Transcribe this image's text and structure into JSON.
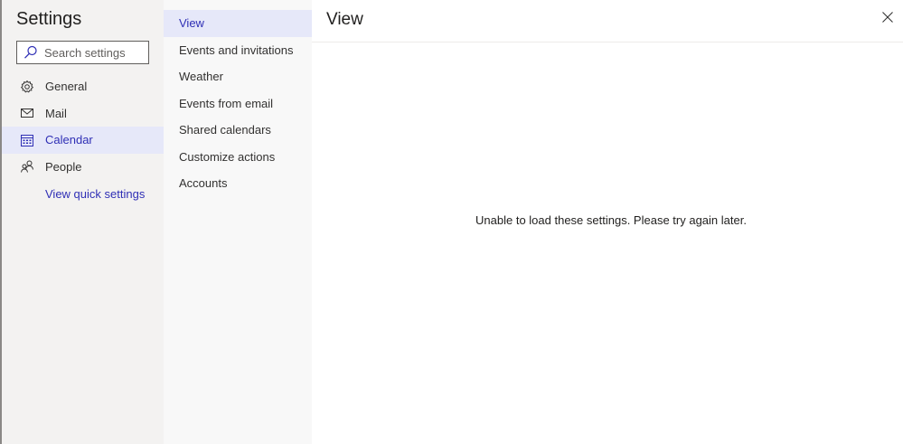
{
  "nav": {
    "title": "Settings",
    "search_placeholder": "Search settings",
    "items": [
      {
        "label": "General",
        "icon": "gear-icon"
      },
      {
        "label": "Mail",
        "icon": "mail-icon"
      },
      {
        "label": "Calendar",
        "icon": "calendar-icon",
        "selected": true
      },
      {
        "label": "People",
        "icon": "people-icon"
      }
    ],
    "quick_settings_link": "View quick settings"
  },
  "subnav": {
    "items": [
      {
        "label": "View",
        "selected": true
      },
      {
        "label": "Events and invitations"
      },
      {
        "label": "Weather"
      },
      {
        "label": "Events from email"
      },
      {
        "label": "Shared calendars"
      },
      {
        "label": "Customize actions"
      },
      {
        "label": "Accounts"
      }
    ]
  },
  "content": {
    "title": "View",
    "message": "Unable to load these settings. Please try again later."
  },
  "colors": {
    "accent": "#2f2fb5",
    "selected_bg": "#e6e8f9",
    "nav_bg": "#f3f2f1"
  }
}
